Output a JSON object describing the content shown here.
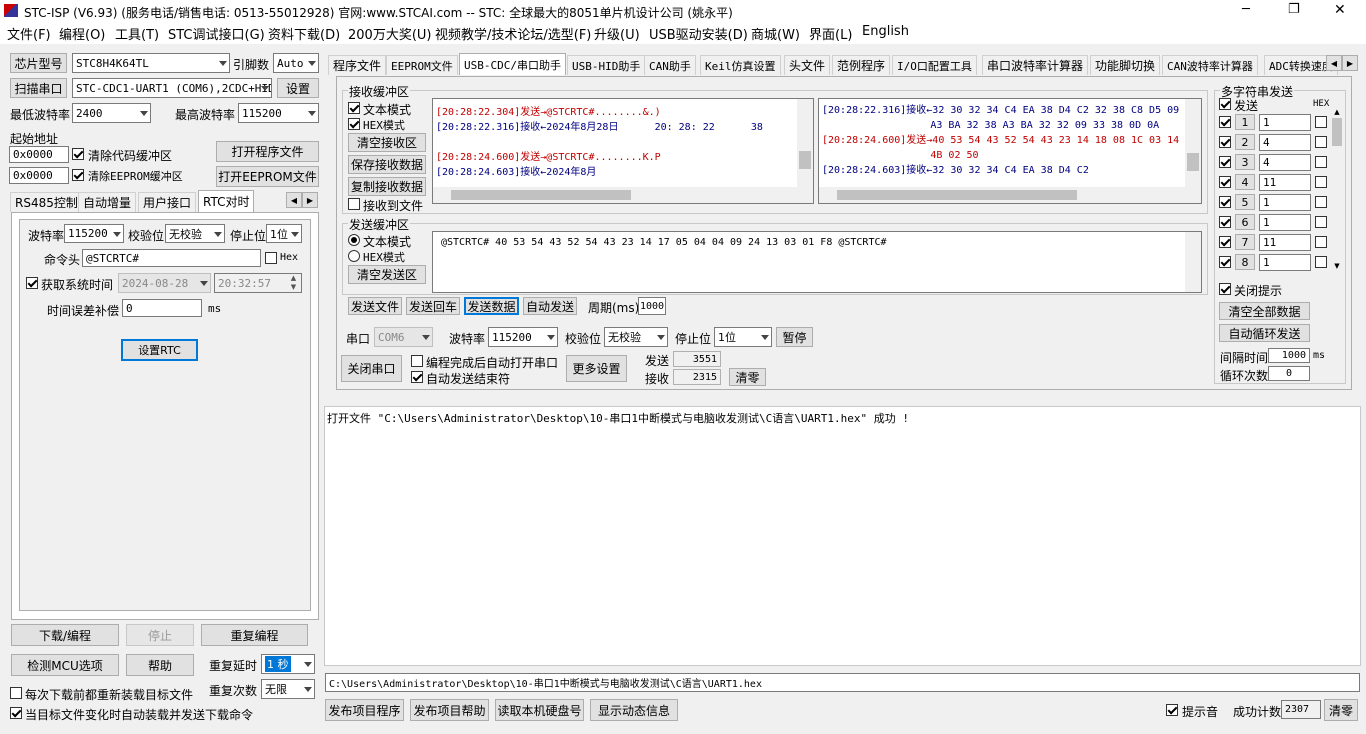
{
  "window": {
    "title": "STC-ISP (V6.93) (服务电话/销售电话: 0513-55012928) 官网:www.STCAI.com  -- STC: 全球最大的8051单片机设计公司 (姚永平)",
    "minimize": "─",
    "maximize": "❐",
    "close": "✕"
  },
  "menu": [
    "文件(F)",
    "编程(O)",
    "工具(T)",
    "STC调试接口(G)",
    "资料下载(D)",
    "200万大奖(U)",
    "视频教学/技术论坛/选型(F)",
    "升级(U)",
    "USB驱动安装(D)",
    "商城(W)",
    "界面(L)",
    "English"
  ],
  "left": {
    "chip_type_btn": "芯片型号",
    "chip_type": "STC8H4K64TL",
    "pin_label": "引脚数",
    "pin_value": "Auto",
    "scan_btn": "扫描串口",
    "port_value": "STC-CDC1-UART1 (COM6),2CDC+HID",
    "settings_btn": "设置",
    "min_baud_label": "最低波特率",
    "min_baud": "2400",
    "max_baud_label": "最高波特率",
    "max_baud": "115200",
    "start_addr_label": "起始地址",
    "addr1": "0x0000",
    "clear_code_label": "清除代码缓冲区",
    "open_prog_btn": "打开程序文件",
    "addr2": "0x0000",
    "clear_eeprom_label": "清除EEPROM缓冲区",
    "open_eeprom_btn": "打开EEPROM文件",
    "tabs": [
      "RS485控制",
      "自动增量",
      "用户接口",
      "RTC对时"
    ],
    "rtc": {
      "baud_label": "波特率",
      "baud": "115200",
      "parity_label": "校验位",
      "parity": "无校验",
      "stop_label": "停止位",
      "stop": "1位",
      "cmd_label": "命令头",
      "cmd": "@STCRTC#",
      "hex_label": "Hex",
      "get_time_label": "获取系统时间",
      "date": "2024-08-28",
      "time": "20:32:57",
      "comp_label": "时间误差补偿",
      "comp": "0",
      "ms": "ms",
      "set_rtc_btn": "设置RTC"
    },
    "download_btn": "下载/编程",
    "stop_btn": "停止",
    "reprog_btn": "重复编程",
    "detect_btn": "检测MCU选项",
    "help_btn": "帮助",
    "delay_label": "重复延时",
    "delay": "1 秒",
    "count_label": "重复次数",
    "count": "无限",
    "reload_label": "每次下载前都重新装载目标文件",
    "auto_label": "当目标文件变化时自动装载并发送下载命令"
  },
  "top_tabs": [
    "程序文件",
    "EEPROM文件",
    "USB-CDC/串口助手",
    "USB-HID助手",
    "CAN助手",
    "Keil仿真设置",
    "头文件",
    "范例程序",
    "I/O口配置工具",
    "串口波特率计算器",
    "功能脚切换",
    "CAN波特率计算器",
    "ADC转换速度"
  ],
  "recv": {
    "title": "接收缓冲区",
    "text_mode": "文本模式",
    "hex_mode": "HEX模式",
    "clear_btn": "清空接收区",
    "save_btn": "保存接收数据",
    "copy_btn": "复制接收数据",
    "to_file": "接收到文件",
    "left_lines": [
      {
        "text": "[20:28:22.304]发送→@STCRTC#........&.)",
        "color": "red"
      },
      {
        "text": "[20:28:22.316]接收←2024年8月28日      20: 28: 22      38",
        "color": "blue"
      },
      {
        "text": "",
        "color": "blue"
      },
      {
        "text": "[20:28:24.600]发送→@STCRTC#........K.P",
        "color": "red"
      },
      {
        "text": "[20:28:24.603]接收←2024年8月",
        "color": "blue"
      }
    ],
    "right_lines": [
      {
        "text": "[20:28:22.316]接收←32 30 32 34 C4 EA 38 D4 C2 32 38 C8 D5 09",
        "color": "blue"
      },
      {
        "text": "                  A3 BA 32 38 A3 BA 32 32 09 33 38 0D 0A",
        "color": "blue"
      },
      {
        "text": "[20:28:24.600]发送→40 53 54 43 52 54 43 23 14 18 08 1C 03 14",
        "color": "red"
      },
      {
        "text": "                  4B 02 50",
        "color": "red"
      },
      {
        "text": "[20:28:24.603]接收←32 30 32 34 C4 EA 38 D4 C2",
        "color": "blue"
      }
    ]
  },
  "send": {
    "title": "发送缓冲区",
    "text_mode": "文本模式",
    "hex_mode": "HEX模式",
    "clear_btn": "清空发送区",
    "content": "@STCRTC# 40 53 54 43 52 54 43 23 14 17 05 04 04 09 24 13 03 01 F8 @STCRTC#",
    "send_file_btn": "发送文件",
    "send_cr_btn": "发送回车",
    "send_data_btn": "发送数据",
    "auto_send_btn": "自动发送",
    "period_label": "周期(ms)",
    "period": "1000"
  },
  "serial": {
    "port_label": "串口",
    "port": "COM6",
    "baud_label": "波特率",
    "baud": "115200",
    "parity_label": "校验位",
    "parity": "无校验",
    "stop_label": "停止位",
    "stop": "1位",
    "pause_btn": "暂停",
    "close_btn": "关闭串口",
    "auto_open_label": "编程完成后自动打开串口",
    "auto_end_label": "自动发送结束符",
    "more_btn": "更多设置",
    "send_label": "发送",
    "send_count": "3551",
    "recv_label": "接收",
    "recv_count": "2315",
    "clear_btn": "清零"
  },
  "multi": {
    "title": "多字符串发送",
    "send_label": "发送",
    "hex_label": "HEX",
    "rows": [
      {
        "n": "1",
        "v": "1"
      },
      {
        "n": "2",
        "v": "4"
      },
      {
        "n": "3",
        "v": "4"
      },
      {
        "n": "4",
        "v": "11"
      },
      {
        "n": "5",
        "v": "1"
      },
      {
        "n": "6",
        "v": "1"
      },
      {
        "n": "7",
        "v": "11"
      },
      {
        "n": "8",
        "v": "1"
      }
    ],
    "close_tip": "关闭提示",
    "clear_all_btn": "清空全部数据",
    "auto_loop_btn": "自动循环发送",
    "interval_label": "间隔时间",
    "interval": "1000",
    "ms": "ms",
    "loop_label": "循环次数",
    "loop": "0"
  },
  "log": "打开文件 \"C:\\Users\\Administrator\\Desktop\\10-串口1中断模式与电脑收发测试\\C语言\\UART1.hex\" 成功 !",
  "path": "C:\\Users\\Administrator\\Desktop\\10-串口1中断模式与电脑收发测试\\C语言\\UART1.hex",
  "bottom": {
    "publish_btn": "发布项目程序",
    "publish_help_btn": "发布项目帮助",
    "read_disk_btn": "读取本机硬盘号",
    "show_info_btn": "显示动态信息",
    "sound_label": "提示音",
    "success_label": "成功计数",
    "success": "2307",
    "clear_btn": "清零"
  }
}
